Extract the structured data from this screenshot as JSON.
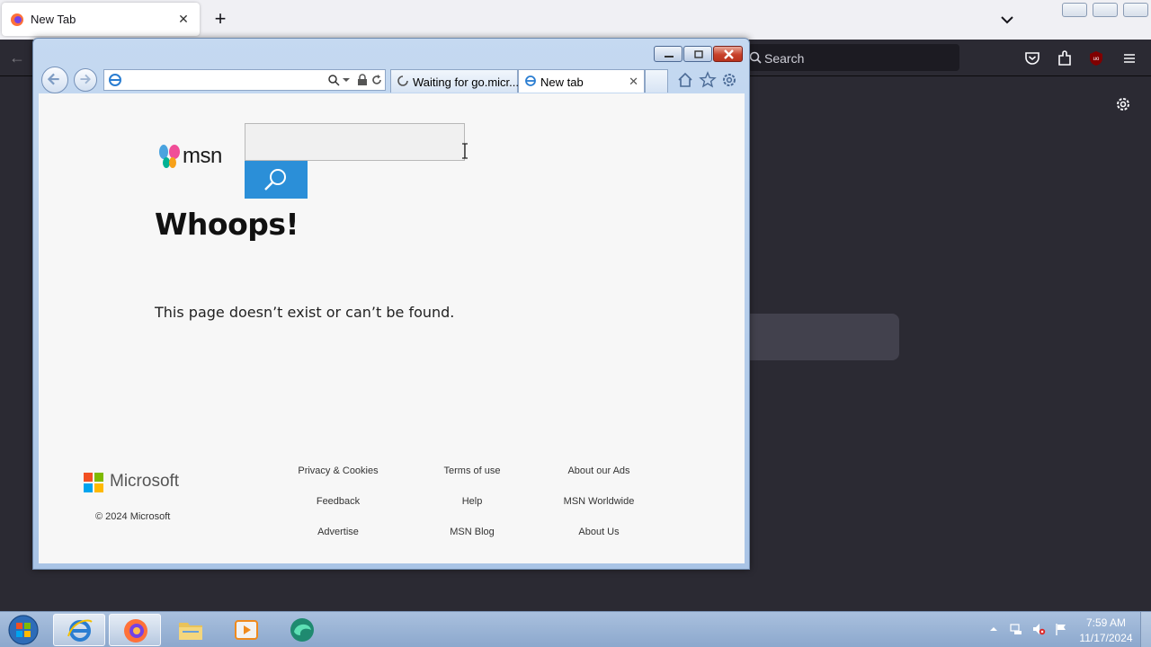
{
  "firefox": {
    "tab_title": "New Tab",
    "search_placeholder": "Search",
    "extension_badge": "uo"
  },
  "ie": {
    "address_value": "",
    "tabs": [
      {
        "label": "Waiting for go.micr..."
      },
      {
        "label": "New tab"
      }
    ]
  },
  "page": {
    "msn_logo_text": "msn",
    "search_value": "",
    "heading": "Whoops!",
    "message": "This page doesn’t exist or can’t be found.",
    "footer": {
      "brand": "Microsoft",
      "copyright": "© 2024 Microsoft",
      "links": [
        "Privacy & Cookies",
        "Terms of use",
        "About our Ads",
        "Feedback",
        "Help",
        "MSN Worldwide",
        "Advertise",
        "MSN Blog",
        "About Us"
      ]
    }
  },
  "taskbar": {
    "time": "7:59 AM",
    "date": "11/17/2024"
  },
  "colors": {
    "msn_search_button": "#2b8fd8",
    "firefox_toolbar": "#2b2a33",
    "taskbar": "#8ca8cd"
  }
}
